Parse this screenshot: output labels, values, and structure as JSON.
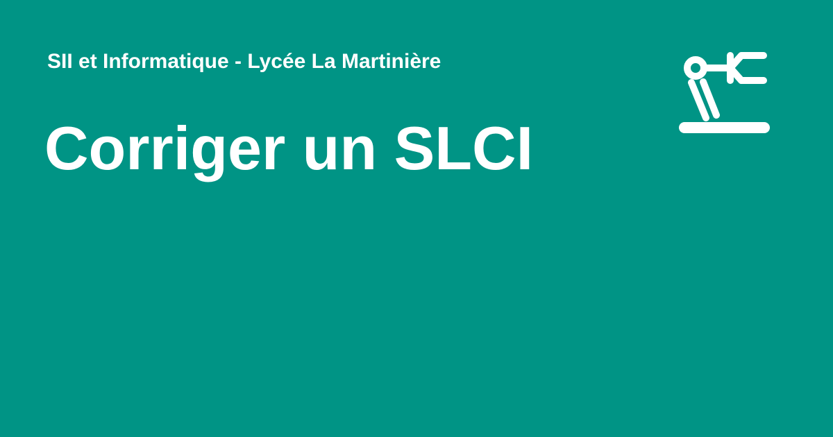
{
  "card": {
    "background_color": "#009485",
    "text_color": "#ffffff",
    "site_name": "SII et Informatique - Lycée La Martinière",
    "page_title": "Corriger un SLCI",
    "logo_icon": "robot-arm-icon"
  }
}
